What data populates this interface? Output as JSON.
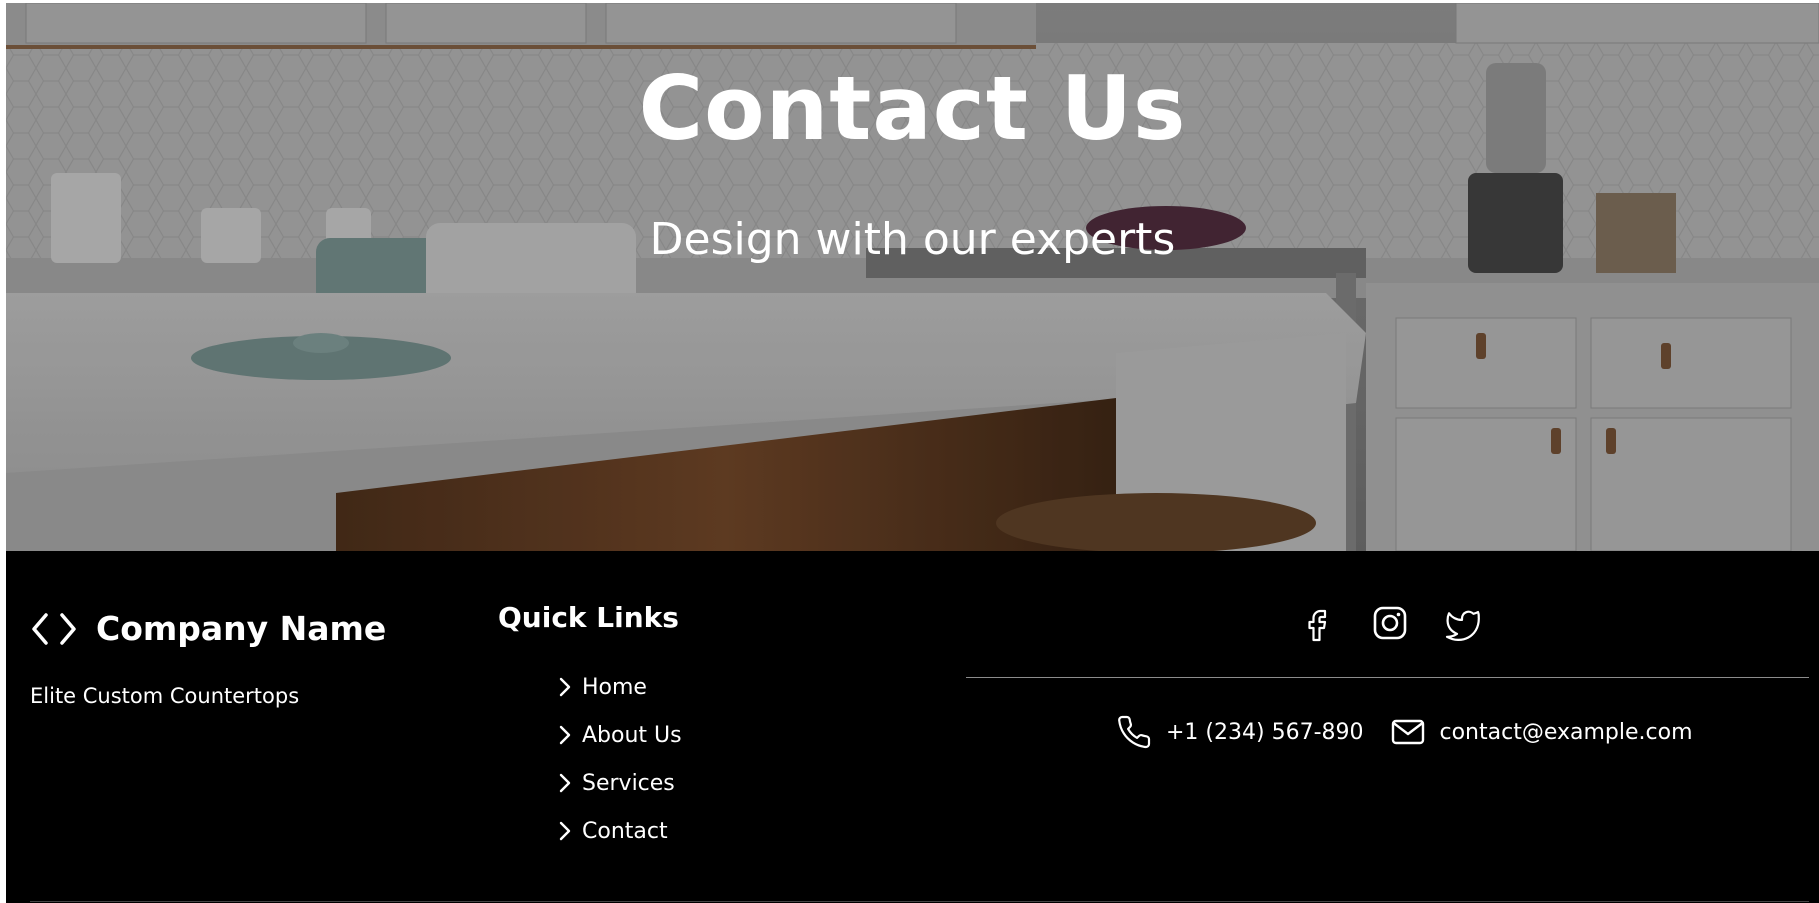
{
  "hero": {
    "title": "Contact Us",
    "subtitle": "Design with our experts"
  },
  "footer": {
    "brand": {
      "icon": "code-icon",
      "name": "Company Name",
      "tagline": "Elite Custom Countertops"
    },
    "quick_links": {
      "title": "Quick Links",
      "items": [
        {
          "label": "Home",
          "icon": "chevron-right-icon"
        },
        {
          "label": "About Us",
          "icon": "chevron-right-icon"
        },
        {
          "label": "Services",
          "icon": "chevron-right-icon"
        },
        {
          "label": "Contact",
          "icon": "chevron-right-icon"
        }
      ]
    },
    "social": [
      {
        "name": "facebook",
        "icon": "facebook-icon"
      },
      {
        "name": "instagram",
        "icon": "instagram-icon"
      },
      {
        "name": "twitter",
        "icon": "twitter-icon"
      }
    ],
    "contact": {
      "phone": "+1 (234) 567-890",
      "email": "contact@example.com"
    }
  },
  "colors": {
    "footer_bg": "#000000",
    "text": "#ffffff",
    "divider": "#8c8c8c"
  }
}
